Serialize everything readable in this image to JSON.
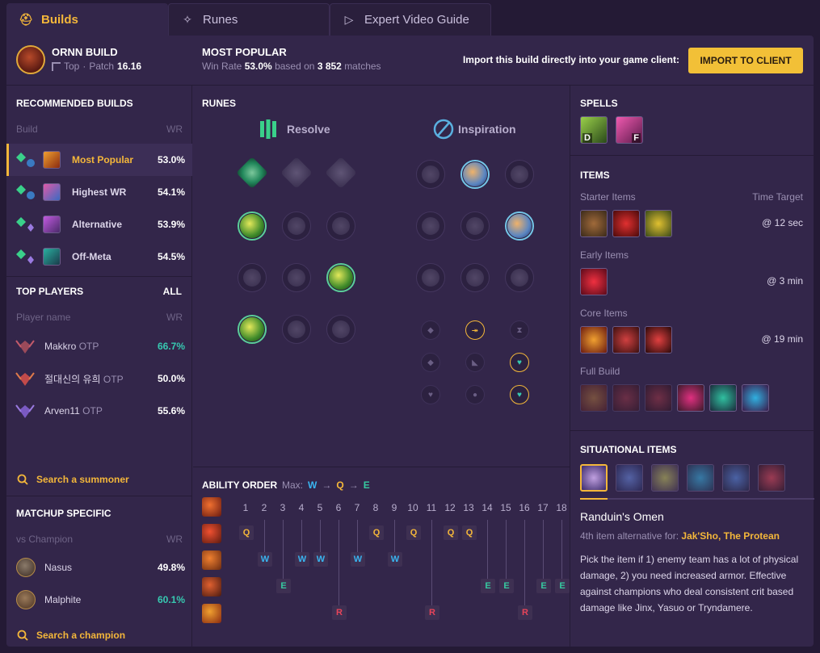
{
  "tabs": [
    {
      "label": "Builds",
      "icon": "helmet-icon"
    },
    {
      "label": "Runes",
      "icon": "runes-icon"
    },
    {
      "label": "Expert Video Guide",
      "icon": "video-icon"
    }
  ],
  "header": {
    "champion_title": "ORNN BUILD",
    "role": "Top",
    "patch_label": "Patch",
    "patch": "16.16",
    "popular_title": "MOST POPULAR",
    "winrate_label": "Win Rate",
    "winrate": "53.0%",
    "based_on": "based on",
    "matches": "3 852",
    "matches_label": "matches",
    "import_text": "Import this build directly into your game client:",
    "import_button": "IMPORT TO CLIENT"
  },
  "recommended": {
    "title": "RECOMMENDED BUILDS",
    "col_build": "Build",
    "col_wr": "WR",
    "builds": [
      {
        "name": "Most Popular",
        "wr": "53.0%"
      },
      {
        "name": "Highest WR",
        "wr": "54.1%"
      },
      {
        "name": "Alternative",
        "wr": "53.9%"
      },
      {
        "name": "Off-Meta",
        "wr": "54.5%"
      }
    ]
  },
  "top_players": {
    "title": "TOP PLAYERS",
    "all": "ALL",
    "col_name": "Player name",
    "col_wr": "WR",
    "players": [
      {
        "name": "Makkro",
        "tag": "OTP",
        "wr": "66.7%"
      },
      {
        "name": "절대신의 유희",
        "tag": "OTP",
        "wr": "50.0%"
      },
      {
        "name": "Arven11",
        "tag": "OTP",
        "wr": "55.6%"
      }
    ],
    "search": "Search a summoner"
  },
  "matchup": {
    "title": "MATCHUP SPECIFIC",
    "col_vs": "vs Champion",
    "col_wr": "WR",
    "rows": [
      {
        "name": "Nasus",
        "wr": "49.8%"
      },
      {
        "name": "Malphite",
        "wr": "60.1%"
      }
    ],
    "search": "Search a champion"
  },
  "runes": {
    "title": "RUNES",
    "primary": "Resolve",
    "secondary": "Inspiration"
  },
  "ability_order": {
    "title": "ABILITY ORDER",
    "max_label": "Max:",
    "max_order": [
      "W",
      "Q",
      "E"
    ],
    "levels": [
      "1",
      "2",
      "3",
      "4",
      "5",
      "6",
      "7",
      "8",
      "9",
      "10",
      "11",
      "12",
      "13",
      "14",
      "15",
      "16",
      "17",
      "18"
    ],
    "rows": [
      {
        "key": "Q",
        "levels": [
          1,
          8,
          10,
          12,
          13
        ]
      },
      {
        "key": "W",
        "levels": [
          2,
          4,
          5,
          7,
          9
        ]
      },
      {
        "key": "E",
        "levels": [
          3,
          14,
          15,
          17,
          18
        ]
      },
      {
        "key": "R",
        "levels": [
          6,
          11,
          16
        ]
      }
    ]
  },
  "spells": {
    "title": "SPELLS",
    "keys": [
      "D",
      "F"
    ]
  },
  "items": {
    "title": "ITEMS",
    "starter": "Starter Items",
    "time_target": "Time Target",
    "starter_time": "@ 12 sec",
    "early": "Early Items",
    "early_time": "@ 3 min",
    "core": "Core Items",
    "core_time": "@ 19 min",
    "full": "Full Build"
  },
  "situational": {
    "title": "SITUATIONAL ITEMS",
    "item_name": "Randuin's Omen",
    "alt_prefix": "4th item alternative for:",
    "alt_items": "Jak'Sho, The Protean",
    "description": "Pick the item if 1) enemy team has a lot of physical damage, 2) you need increased armor. Effective against champions who deal consistent crit based damage like Jinx, Yasuo or Tryndamere."
  },
  "colors": {
    "accent": "#f4b73a",
    "panel": "#33264a",
    "background": "#241a35",
    "green_wr": "#37c9b1",
    "q": "#f4b73a",
    "w": "#3ab5f0",
    "e": "#37c9a0",
    "r": "#e8445a"
  }
}
